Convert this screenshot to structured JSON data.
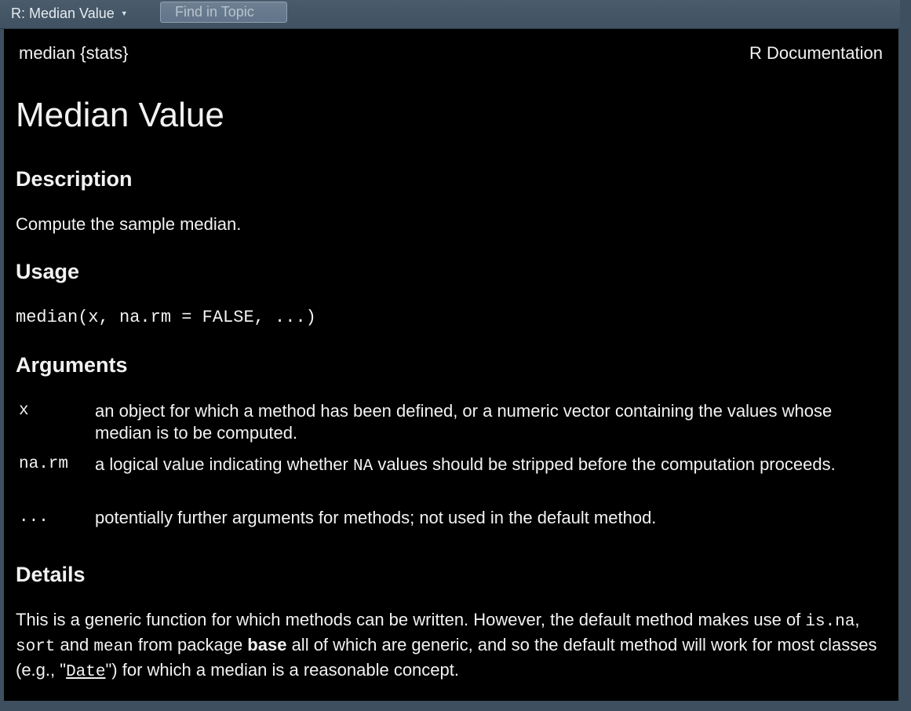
{
  "toolbar": {
    "topic_title": "R: Median Value",
    "find_placeholder": "Find in Topic"
  },
  "doc": {
    "header_left": "median {stats}",
    "header_right": "R Documentation",
    "title": "Median Value",
    "description": {
      "heading": "Description",
      "text": "Compute the sample median."
    },
    "usage": {
      "heading": "Usage",
      "code": "median(x, na.rm = FALSE, ...)"
    },
    "arguments": {
      "heading": "Arguments",
      "items": [
        {
          "name": "x",
          "desc": "an object for which a method has been defined, or a numeric vector containing the values whose median is to be computed."
        },
        {
          "name": "na.rm",
          "desc_before": "a logical value indicating whether ",
          "desc_code": "NA",
          "desc_after": " values should be stripped before the computation proceeds."
        },
        {
          "name": "...",
          "desc": "potentially further arguments for methods; not used in the default method."
        }
      ]
    },
    "details": {
      "heading": "Details",
      "t1": "This is a generic function for which methods can be written. However, the default method makes use of ",
      "c1": "is.na",
      "t2": ", ",
      "c2": "sort",
      "t3": " and ",
      "c3": "mean",
      "t4": " from package ",
      "b1": "base",
      "t5": " all of which are generic, and so the default method will work for most classes (e.g., \"",
      "link": "Date",
      "t6": "\") for which a median is a reasonable concept."
    }
  }
}
